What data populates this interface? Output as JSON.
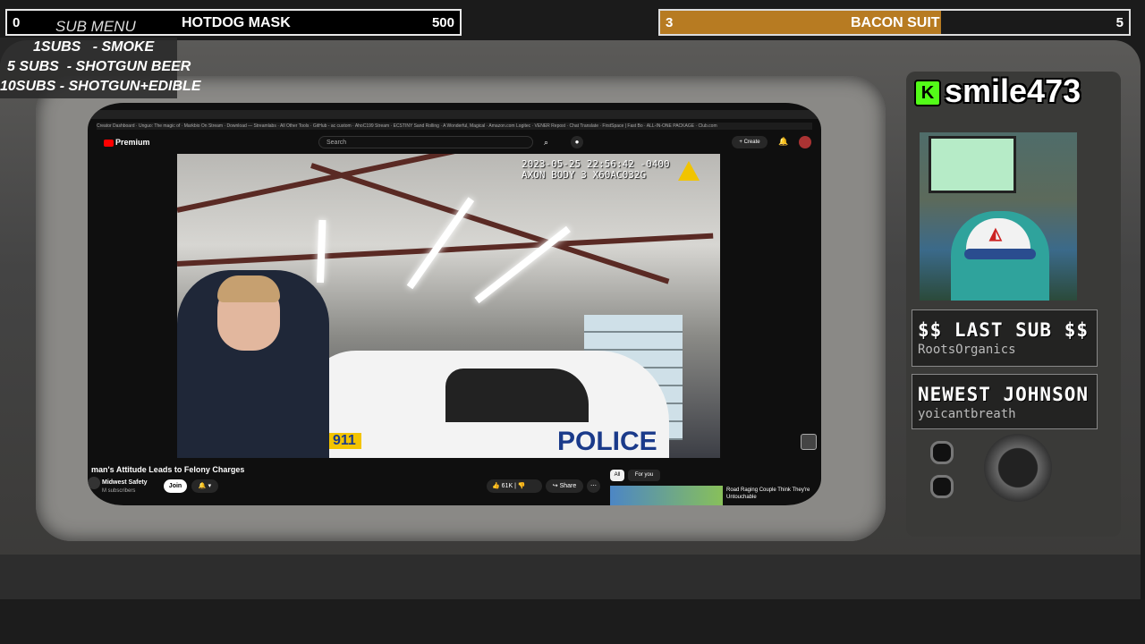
{
  "goals": {
    "left": {
      "start": "0",
      "label": "HOTDOG MASK",
      "target": "500"
    },
    "right": {
      "start": "3",
      "label": "BACON SUIT",
      "target": "5",
      "progress_fraction": 0.6,
      "color": "#b77b22"
    }
  },
  "sub_menu": {
    "title": "SUB MENU",
    "items": [
      "1SUBS   - SMOKE",
      "5 SUBS  - SHOTGUN BEER",
      "10SUBS - SHOTGUN+EDIBLE"
    ]
  },
  "browser": {
    "bookmarks": "Creator Dashboard · Unguo: The magic of · Markbio On Stream · Download — Streamlabs · All Other Tools · GitHub - ac custom · AhoC199 Stream · ECSTINY Sand Rolling · A Wonderful, Magical · Amazon.com Logitec · VENER Repost · Chat Translate · FirstSpace | Fast Bo · ALL-IN-ONE PACKAGE · Club.com"
  },
  "youtube": {
    "logo": "Premium",
    "search_placeholder": "Search",
    "create_label": "+ Create",
    "video": {
      "timestamp_line1": "2023-05-25 22:56:42 -0400",
      "timestamp_line2": "AXON BODY 3 X60AC032G",
      "car_text": "POLICE",
      "car_number": "911"
    },
    "title": "man's Attitude Leads to Felony Charges",
    "channel": "Midwest Safety",
    "subscribers": "M subscribers",
    "join_label": "Join",
    "likes": "61K",
    "share_label": "Share",
    "chips": [
      "All",
      "For you"
    ],
    "recommended_title": "Road Raging Couple Think They're Untouchable"
  },
  "streamer": {
    "name": "smile473",
    "kick_icon": "K"
  },
  "last_sub": {
    "heading": "$$ LAST SUB $$",
    "value": "RootsOrganics"
  },
  "newest": {
    "heading": "NEWEST JOHNSON",
    "value": "yoicantbreath"
  },
  "colors": {
    "accent": "#b77b22",
    "kick_green": "#53fc18",
    "yt_red": "#ff0000"
  }
}
